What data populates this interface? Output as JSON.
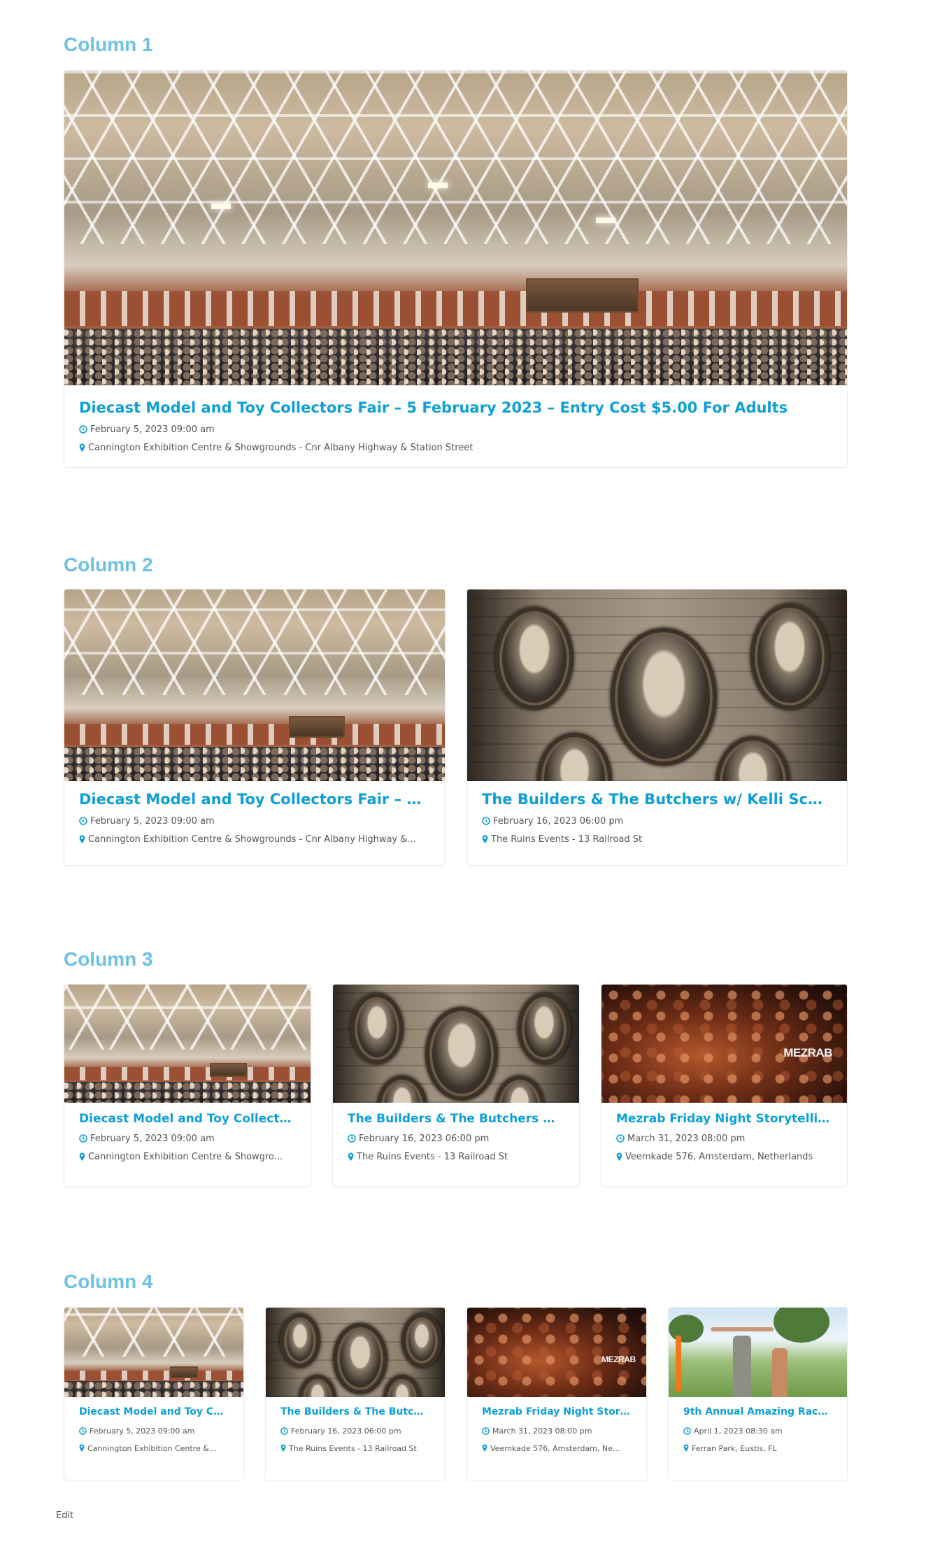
{
  "sections": [
    {
      "title": "Column 1"
    },
    {
      "title": "Column 2"
    },
    {
      "title": "Column 3"
    },
    {
      "title": "Column 4"
    }
  ],
  "events": {
    "diecast": {
      "title": "Diecast Model and Toy Collectors Fair – 5 February 2023 – Entry Cost $5.00 For Adults",
      "title_short": "Diecast Model and Toy Collectors Fair – 5 F...",
      "title_c3": "Diecast Model and Toy Collecto...",
      "title_c4": "Diecast Model and Toy Co...",
      "date": "February 5, 2023 09:00 am",
      "location": "Cannington Exhibition Centre & Showgrounds - Cnr Albany Highway & Station Street",
      "location_c2": "Cannington Exhibition Centre & Showgrounds - Cnr Albany Highway &...",
      "location_c3": "Cannington Exhibition Centre & Showgro...",
      "location_c4": "Cannington Exhibition Centre &...",
      "image": "exhibition-hall-crowd"
    },
    "builders": {
      "title_c2": "The Builders & The Butchers w/ Kelli Scha...",
      "title_c3": "The Builders & The Butchers w/...",
      "title_c4": "The Builders & The Butch...",
      "date": "February 16, 2023 06:00 pm",
      "location": "The Ruins Events - 13 Railroad St",
      "image": "band-portraits-frames"
    },
    "mezrab": {
      "title": "Mezrab Friday Night Storytelling",
      "title_c4": "Mezrab Friday Night Story...",
      "date": "March 31, 2023 08:00 pm",
      "location": "Veemkade 576, Amsterdam, Netherlands",
      "location_c4": "Veemkade 576, Amsterdam, Ne...",
      "logo": "MEZRAB",
      "image": "audience-crowd"
    },
    "race": {
      "title_c4": "9th Annual Amazing Race...",
      "date": "April 1, 2023 08:30 am",
      "location": "Ferran Park, Eustis, FL",
      "image": "park-race-finish"
    }
  },
  "icons": {
    "date": "clock-icon",
    "location": "map-marker-icon"
  },
  "colors": {
    "heading": "#6ec1e4",
    "title": "#0d9fd8",
    "meta": "#555555"
  },
  "footer": {
    "edit_label": "Edit"
  }
}
